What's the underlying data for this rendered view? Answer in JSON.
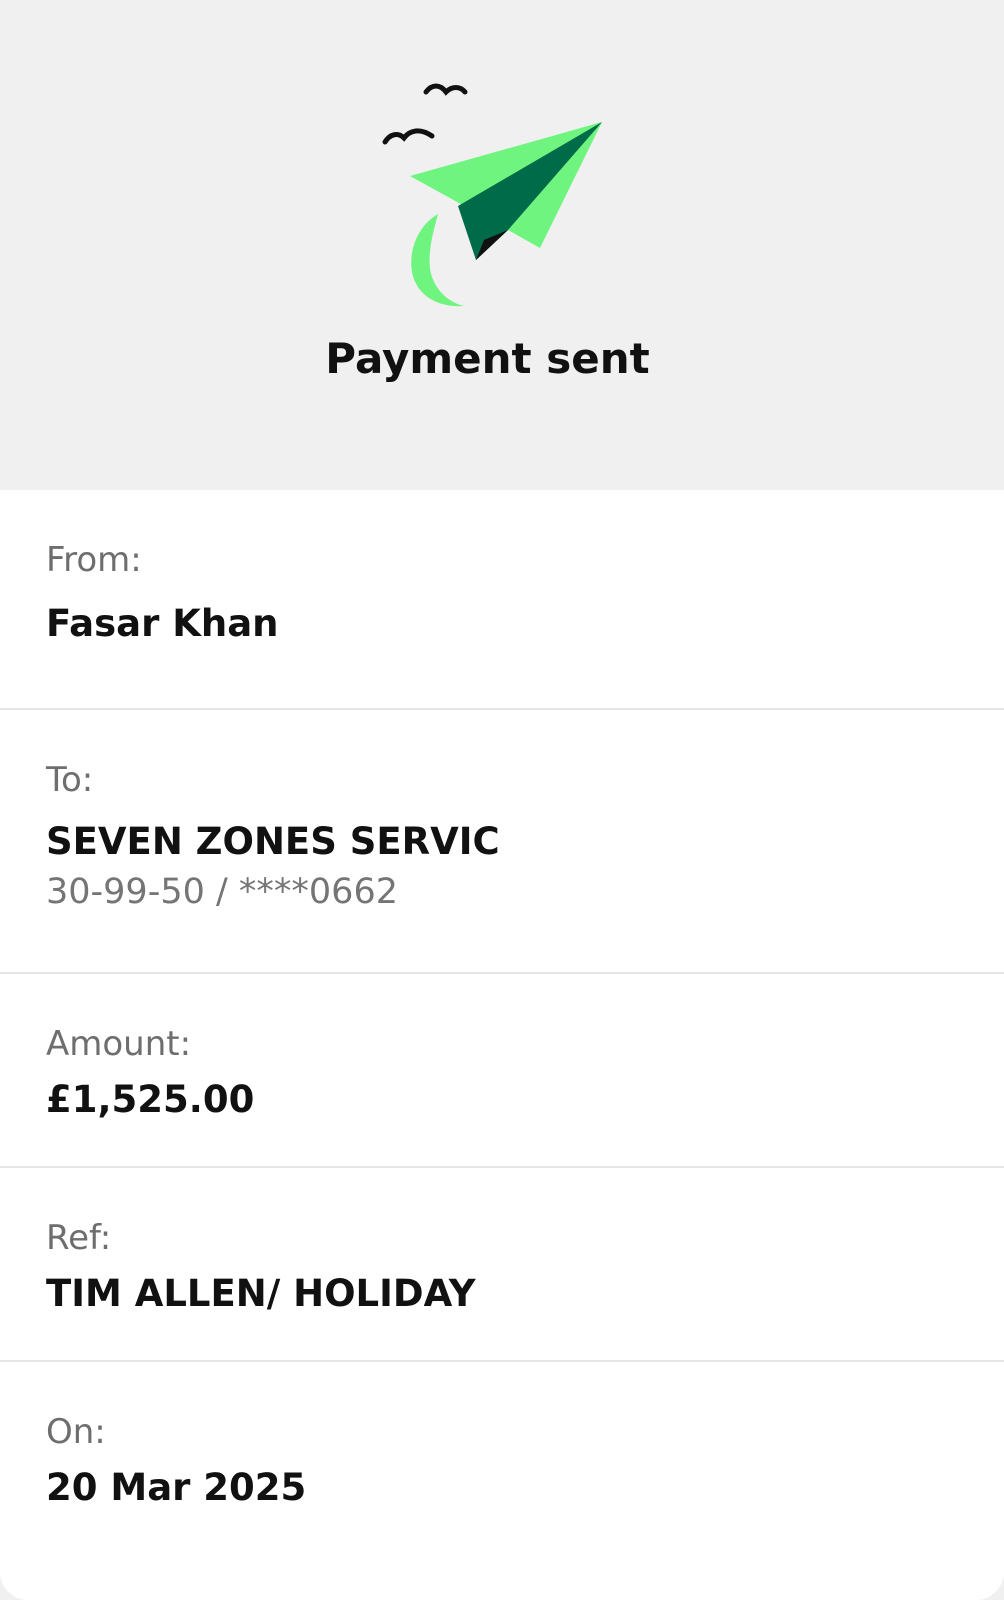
{
  "header": {
    "title": "Payment sent",
    "illustration_icon": "paper-plane-with-birds-icon"
  },
  "details": {
    "from": {
      "label": "From:",
      "value": "Fasar Khan"
    },
    "to": {
      "label": "To:",
      "value": "SEVEN ZONES SERVIC",
      "account": "30-99-50 / ****0662"
    },
    "amount": {
      "label": "Amount:",
      "value": "£1,525.00"
    },
    "reference": {
      "label": "Ref:",
      "value": "TIM ALLEN/ HOLIDAY"
    },
    "date": {
      "label": "On:",
      "value": "20 Mar 2025"
    }
  },
  "colors": {
    "plane_light": "#6ff57f",
    "plane_dark": "#006b48",
    "birds": "#111111",
    "background": "#f0f0f0",
    "card": "#ffffff"
  }
}
